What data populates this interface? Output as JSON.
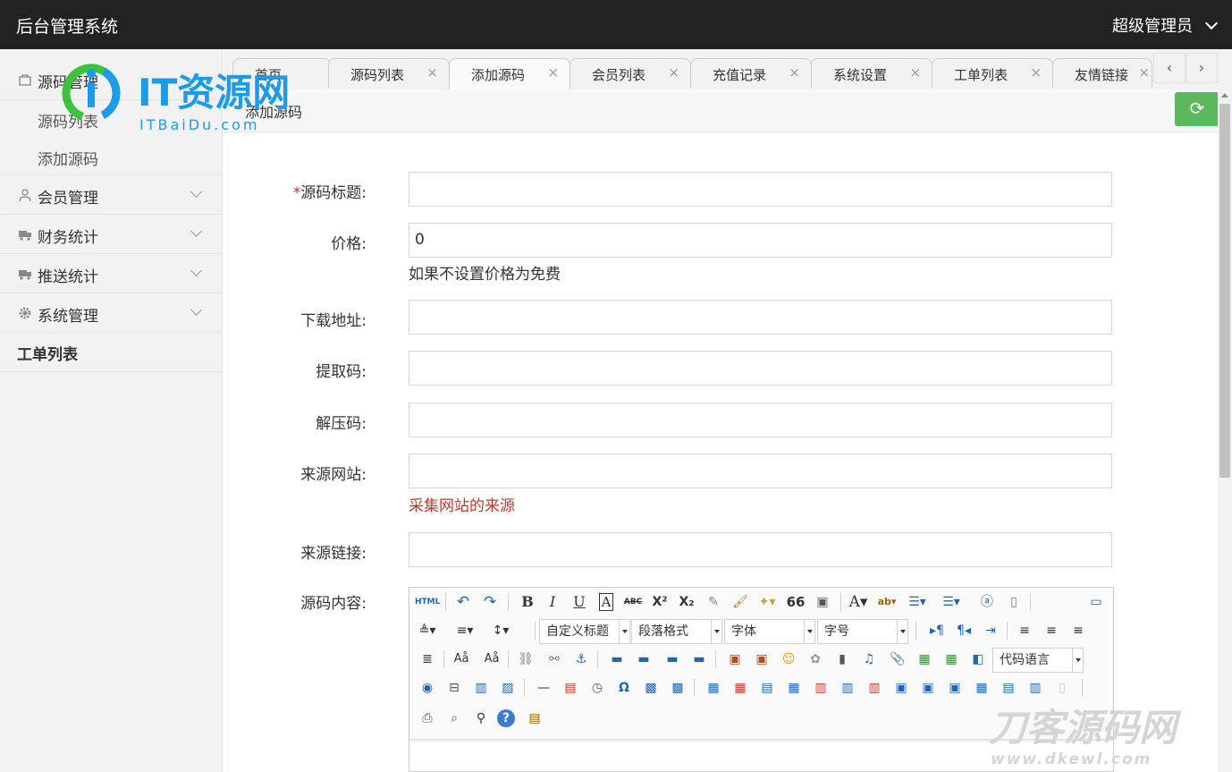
{
  "header": {
    "brand": "后台管理系统",
    "user": "超级管理员"
  },
  "logo": {
    "text": "IT资源网",
    "sub": "ITBaiDu.com"
  },
  "sidebar": {
    "groups": [
      {
        "label": "源码管理",
        "icon": "bag-icon",
        "children": [
          "源码列表",
          "添加源码"
        ]
      },
      {
        "label": "会员管理",
        "icon": "user-icon"
      },
      {
        "label": "财务统计",
        "icon": "truck-icon"
      },
      {
        "label": "推送统计",
        "icon": "truck-icon"
      },
      {
        "label": "系统管理",
        "icon": "gear-icon"
      }
    ],
    "single": "工单列表"
  },
  "tabs": [
    {
      "label": "首页",
      "closable": false
    },
    {
      "label": "源码列表",
      "closable": true
    },
    {
      "label": "添加源码",
      "closable": true,
      "active": true
    },
    {
      "label": "会员列表",
      "closable": true
    },
    {
      "label": "充值记录",
      "closable": true
    },
    {
      "label": "系统设置",
      "closable": true
    },
    {
      "label": "工单列表",
      "closable": true
    },
    {
      "label": "友情链接",
      "closable": true
    }
  ],
  "tab_close": "×",
  "tab_nav": {
    "prev": "‹",
    "next": "›"
  },
  "page": {
    "title": "添加源码",
    "refresh_icon": "⟳"
  },
  "form": {
    "title": {
      "label": "源码标题:",
      "required": "*",
      "value": ""
    },
    "price": {
      "label": "价格:",
      "value": "0",
      "hint": "如果不设置价格为免费"
    },
    "download": {
      "label": "下载地址:",
      "value": ""
    },
    "extract": {
      "label": "提取码:",
      "value": ""
    },
    "unzip": {
      "label": "解压码:",
      "value": ""
    },
    "source_site": {
      "label": "来源网站:",
      "value": "",
      "hint": "采集网站的来源"
    },
    "source_link": {
      "label": "来源链接:",
      "value": ""
    },
    "content": {
      "label": "源码内容:"
    }
  },
  "editor": {
    "selects": {
      "custom_title": "自定义标题",
      "paragraph": "段落格式",
      "font": "字体",
      "size": "字号",
      "code_lang": "代码语言"
    },
    "buttons": {
      "html": "HTML",
      "bold": "B",
      "italic": "I",
      "underline": "U",
      "border_a": "A",
      "strike": "ABC",
      "sup": "X²",
      "sub": "X₂",
      "quote": "66",
      "font_color": "A",
      "omega": "Ω"
    }
  },
  "watermark": {
    "text": "刀客源码网",
    "sub": "www.dkewl.com"
  },
  "colors": {
    "topbar": "#222222",
    "sidebar": "#f2f2f2",
    "refresh": "#5cb85c",
    "required": "#e02020",
    "hint_red": "#c0392b"
  }
}
